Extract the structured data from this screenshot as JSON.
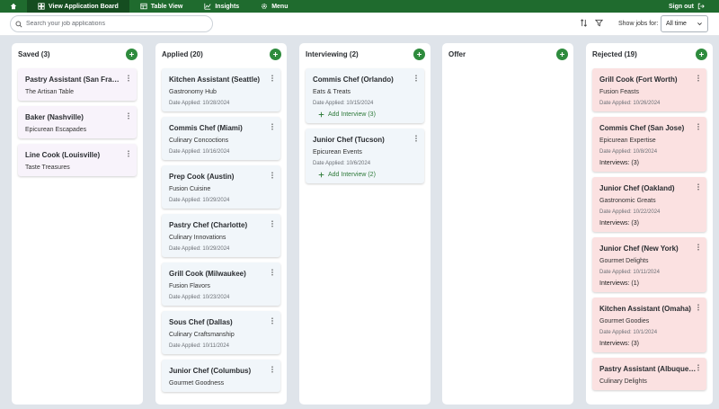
{
  "nav": {
    "items": [
      {
        "label": "View Application Board",
        "icon": "grid-icon",
        "active": true
      },
      {
        "label": "Table View",
        "icon": "table-icon",
        "active": false
      },
      {
        "label": "Insights",
        "icon": "chart-icon",
        "active": false
      },
      {
        "label": "Menu",
        "icon": "gear-icon",
        "active": false
      }
    ],
    "signout": "Sign out"
  },
  "toolbar": {
    "search_placeholder": "Search your job applications",
    "show_jobs_label": "Show jobs for:",
    "show_jobs_value": "All time"
  },
  "colors": {
    "nav_bg": "#1f6b2e",
    "accent": "#2e8b3d",
    "saved_card": "#f8f3fb",
    "applied_card": "#f1f6fa",
    "rejected_card": "#fbe1e1"
  },
  "columns": [
    {
      "title": "Saved (3)",
      "kind": "saved",
      "cards": [
        {
          "title": "Pastry Assistant (San Francisco)",
          "company": "The Artisan Table"
        },
        {
          "title": "Baker (Nashville)",
          "company": "Epicurean Escapades"
        },
        {
          "title": "Line Cook (Louisville)",
          "company": "Taste Treasures"
        }
      ]
    },
    {
      "title": "Applied (20)",
      "kind": "applied",
      "cards": [
        {
          "title": "Kitchen Assistant (Seattle)",
          "company": "Gastronomy Hub",
          "date": "Date Applied: 10/28/2024"
        },
        {
          "title": "Commis Chef (Miami)",
          "company": "Culinary Concoctions",
          "date": "Date Applied: 10/16/2024"
        },
        {
          "title": "Prep Cook (Austin)",
          "company": "Fusion Cuisine",
          "date": "Date Applied: 10/29/2024"
        },
        {
          "title": "Pastry Chef (Charlotte)",
          "company": "Culinary Innovations",
          "date": "Date Applied: 10/29/2024"
        },
        {
          "title": "Grill Cook (Milwaukee)",
          "company": "Fusion Flavors",
          "date": "Date Applied: 10/23/2024"
        },
        {
          "title": "Sous Chef (Dallas)",
          "company": "Culinary Craftsmanship",
          "date": "Date Applied: 10/11/2024"
        },
        {
          "title": "Junior Chef (Columbus)",
          "company": "Gourmet Goodness",
          "date": ""
        }
      ]
    },
    {
      "title": "Interviewing (2)",
      "kind": "interviewing",
      "cards": [
        {
          "title": "Commis Chef (Orlando)",
          "company": "Eats & Treats",
          "date": "Date Applied: 10/15/2024",
          "action": "Add Interview (3)"
        },
        {
          "title": "Junior Chef (Tucson)",
          "company": "Epicurean Events",
          "date": "Date Applied: 10/6/2024",
          "action": "Add Interview (2)"
        }
      ]
    },
    {
      "title": "Offer",
      "kind": "offer",
      "cards": []
    },
    {
      "title": "Rejected (19)",
      "kind": "rejected",
      "cards": [
        {
          "title": "Grill Cook (Fort Worth)",
          "company": "Fusion Feasts",
          "date": "Date Applied: 10/26/2024"
        },
        {
          "title": "Commis Chef (San Jose)",
          "company": "Epicurean Expertise",
          "date": "Date Applied: 10/8/2024",
          "extra": "Interviews: (3)"
        },
        {
          "title": "Junior Chef (Oakland)",
          "company": "Gastronomic Greats",
          "date": "Date Applied: 10/22/2024",
          "extra": "Interviews: (3)"
        },
        {
          "title": "Junior Chef (New York)",
          "company": "Gourmet Delights",
          "date": "Date Applied: 10/11/2024",
          "extra": "Interviews: (1)"
        },
        {
          "title": "Kitchen Assistant (Omaha)",
          "company": "Gourmet Goodies",
          "date": "Date Applied: 10/1/2024",
          "extra": "Interviews: (3)"
        },
        {
          "title": "Pastry Assistant (Albuquerque)",
          "company": "Culinary Delights",
          "date": ""
        }
      ]
    }
  ]
}
